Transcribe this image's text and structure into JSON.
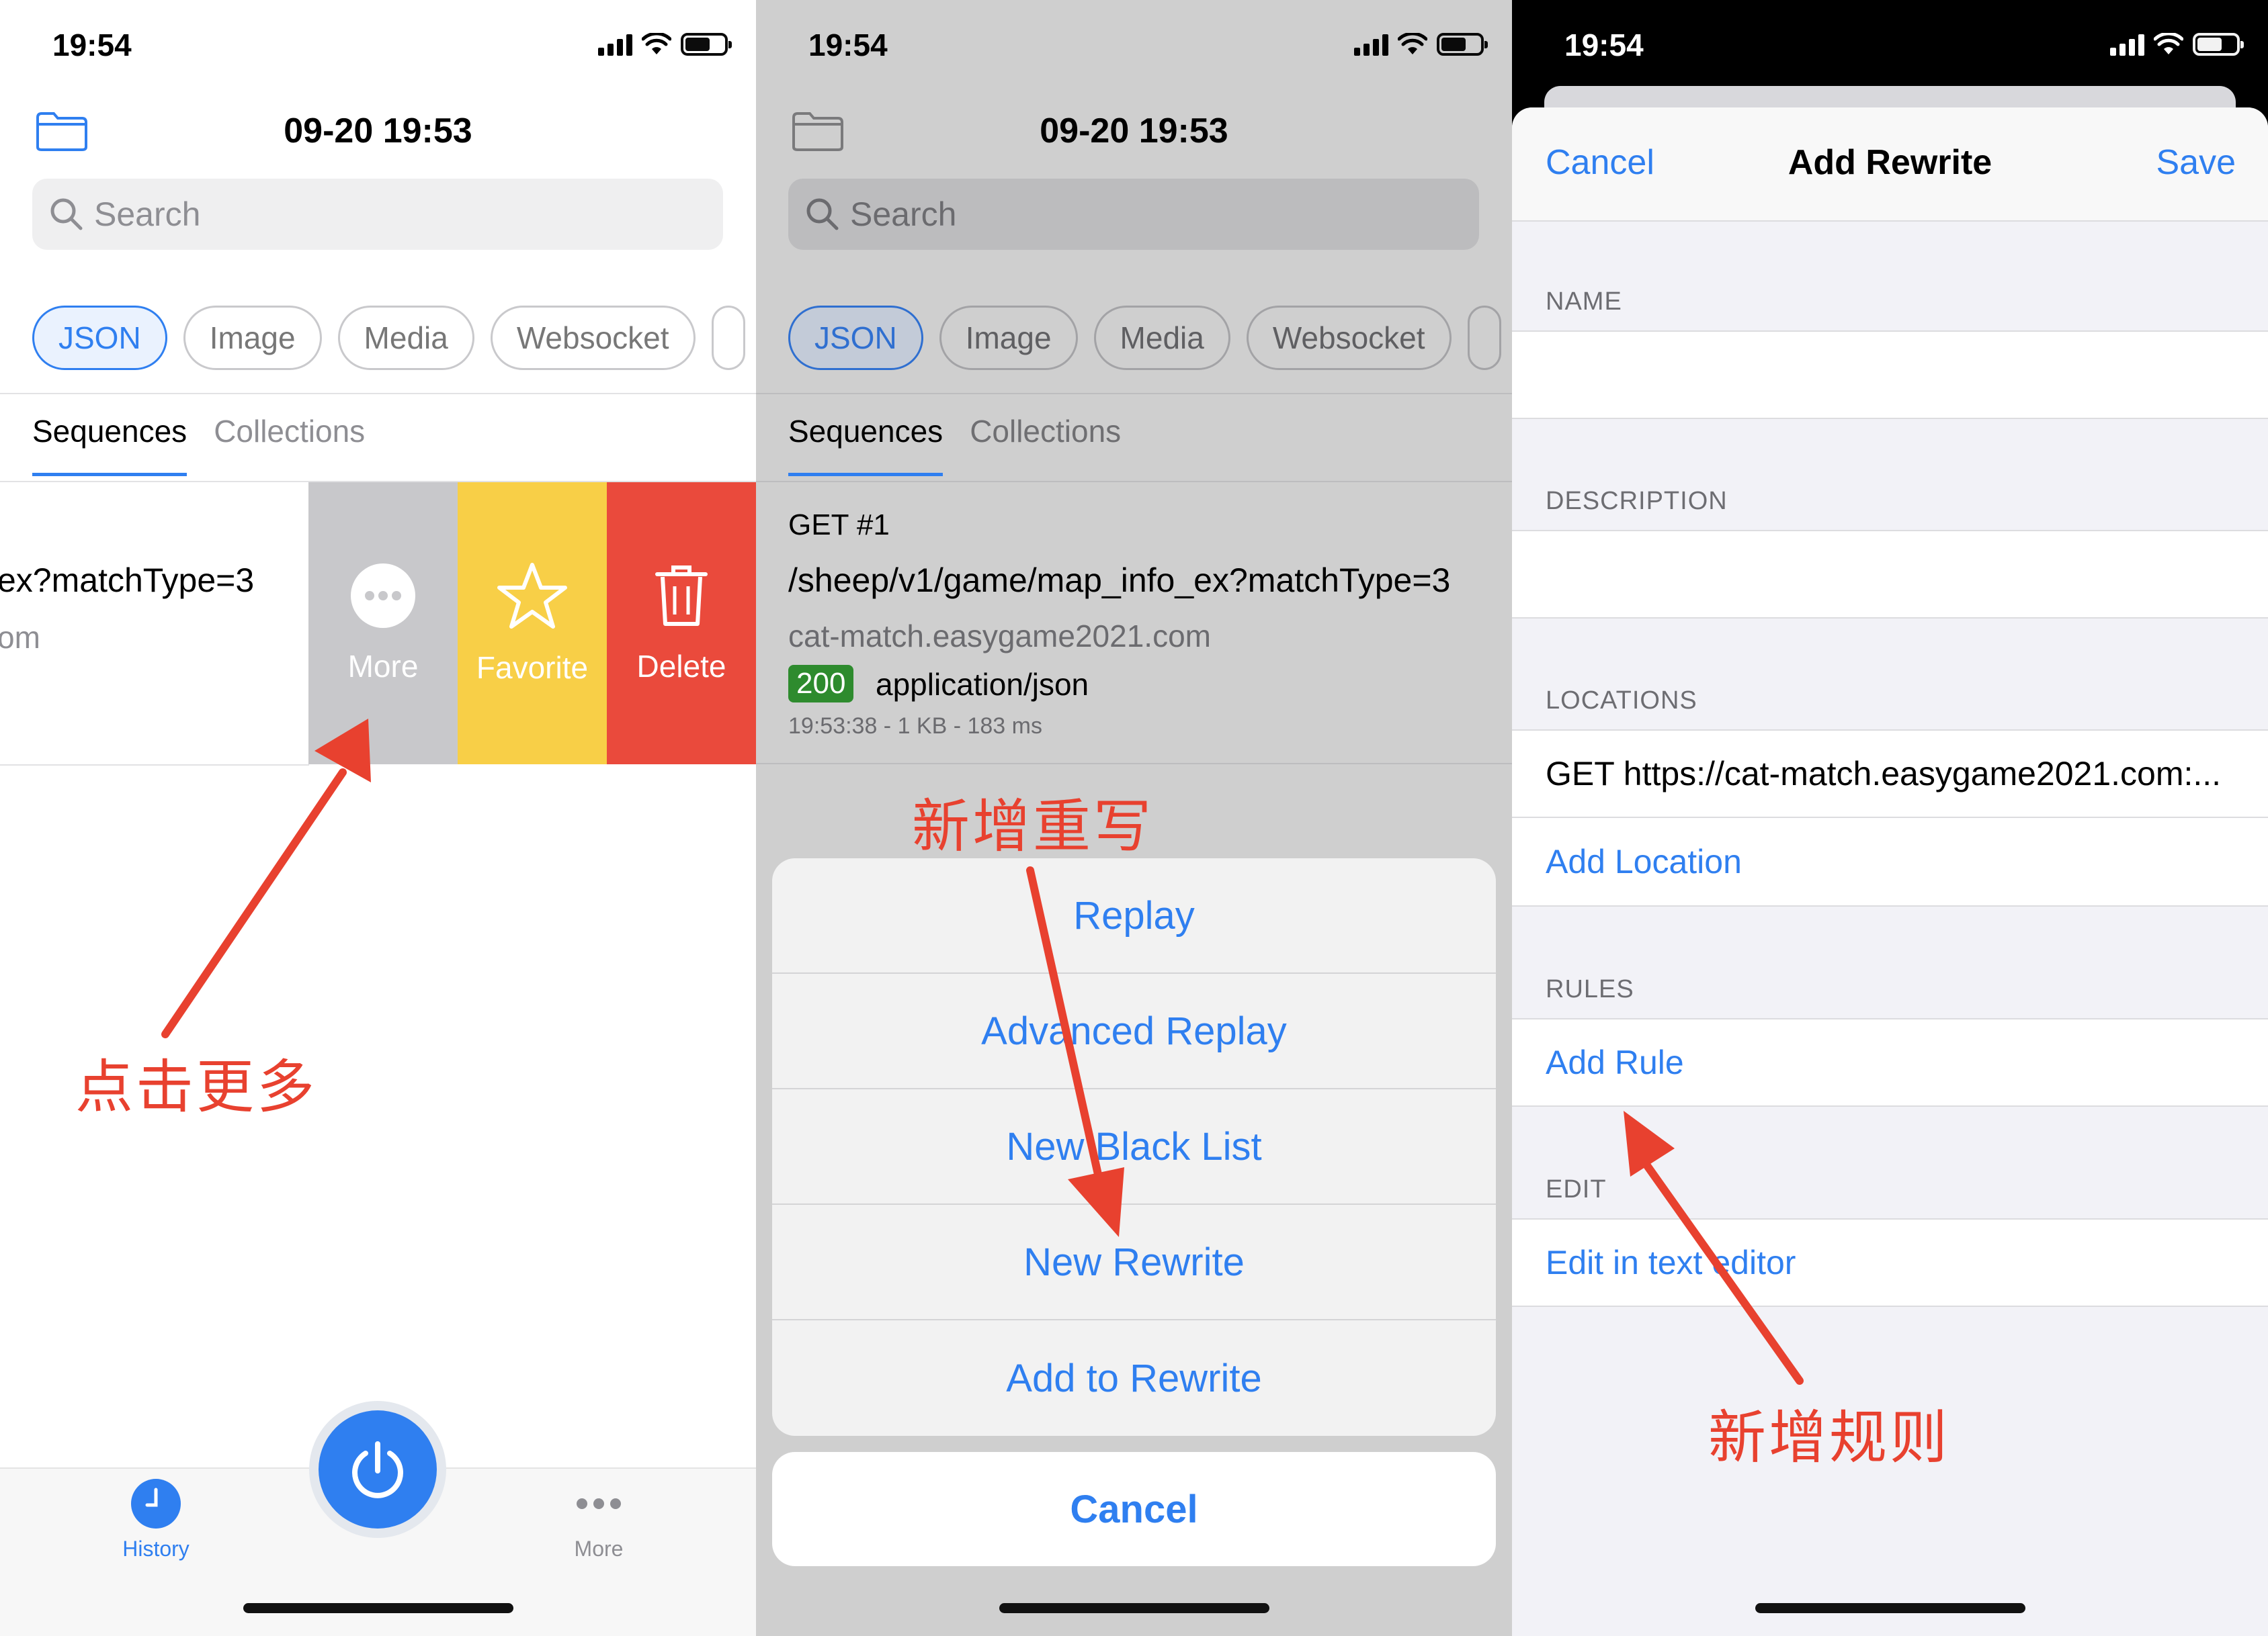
{
  "status": {
    "time": "19:54"
  },
  "header": {
    "title": "09-20 19:53",
    "search_placeholder": "Search"
  },
  "chips": [
    "JSON",
    "Image",
    "Media",
    "Websocket"
  ],
  "tabs": {
    "sequences": "Sequences",
    "collections": "Collections"
  },
  "panel1": {
    "row_path_fragment": "ex?matchType=3",
    "row_host_fragment": "om",
    "actions": {
      "more": "More",
      "favorite": "Favorite",
      "delete": "Delete"
    },
    "annotation": "点击更多",
    "tabbar": {
      "history": "History",
      "more": "More"
    }
  },
  "panel2": {
    "request": {
      "method_line": "GET  #1",
      "path": "/sheep/v1/game/map_info_ex?matchType=3",
      "host": "cat-match.easygame2021.com",
      "status_code": "200",
      "content_type": "application/json",
      "meta": "19:53:38 - 1 KB - 183 ms"
    },
    "annotation": "新增重写",
    "sheet_items": [
      "Replay",
      "Advanced Replay",
      "New Black List",
      "New Rewrite",
      "Add to Rewrite"
    ],
    "cancel": "Cancel"
  },
  "panel3": {
    "cancel": "Cancel",
    "title": "Add Rewrite",
    "save": "Save",
    "sections": {
      "name": "NAME",
      "description": "DESCRIPTION",
      "locations": "LOCATIONS",
      "rules": "RULES",
      "edit": "EDIT"
    },
    "location_value": "GET https://cat-match.easygame2021.com:...",
    "add_location": "Add Location",
    "add_rule": "Add Rule",
    "edit_in_text_editor": "Edit in text editor",
    "annotation": "新增规则"
  },
  "colors": {
    "accent": "#2f7ff0",
    "more_action": "#c8c8cb",
    "favorite_action": "#f8cf47",
    "delete_action": "#ea4a3c",
    "annotation_red": "#e8412f",
    "status_green": "#2e8b2e"
  },
  "icons": [
    "folder-icon",
    "search-icon",
    "ellipsis-icon",
    "star-icon",
    "trash-icon",
    "clock-icon",
    "power-icon",
    "signal-icon",
    "wifi-icon",
    "battery-icon"
  ]
}
